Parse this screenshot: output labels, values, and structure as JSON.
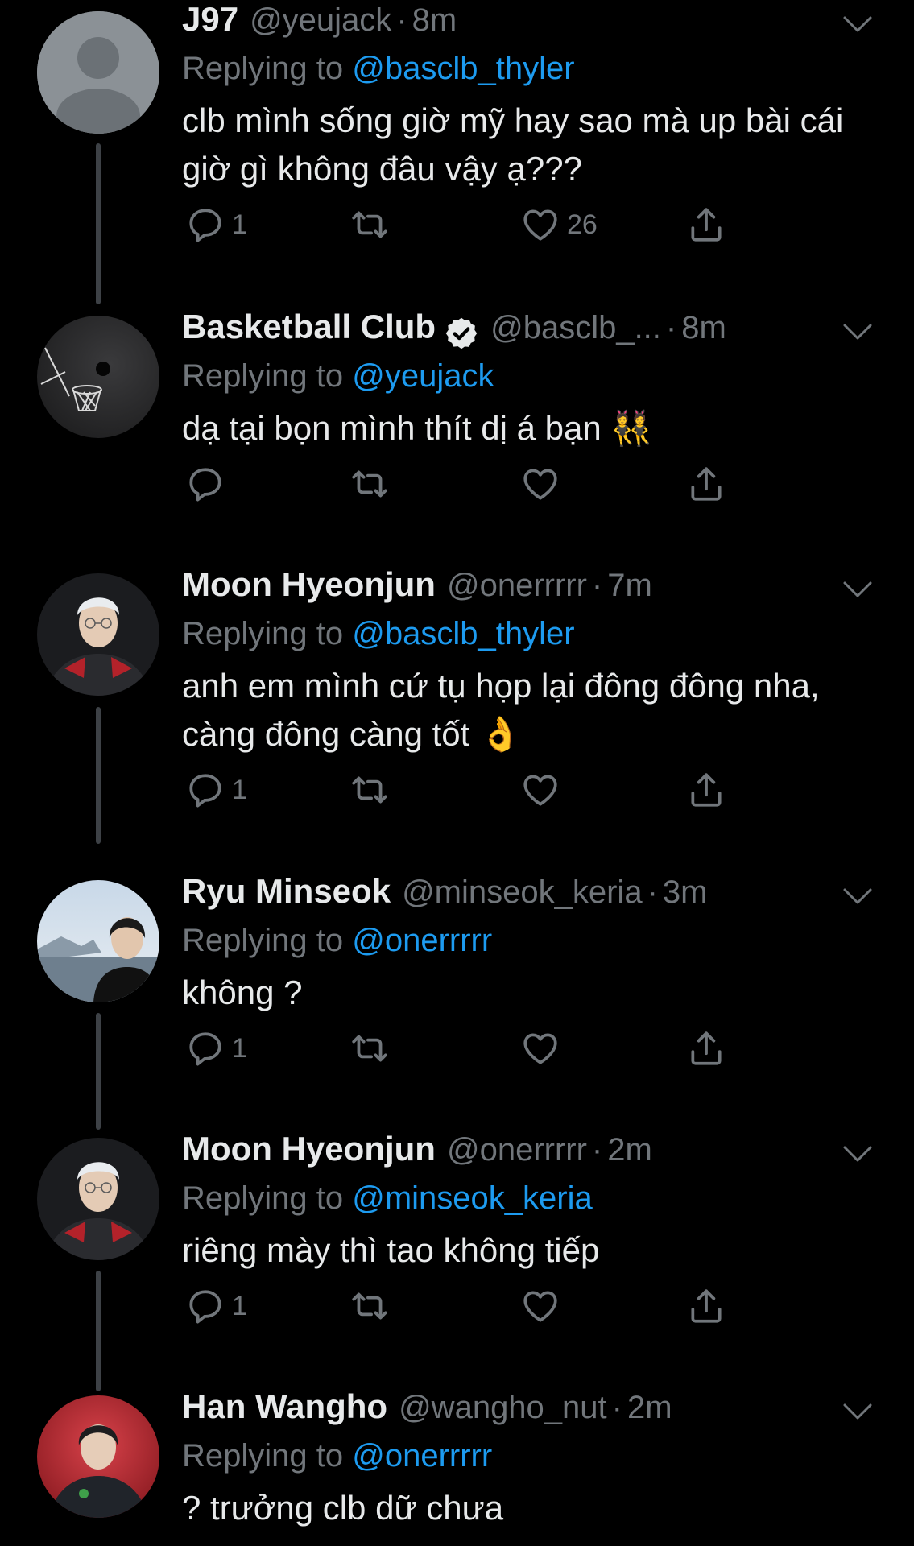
{
  "tweets": [
    {
      "name": "J97",
      "handle": "@yeujack",
      "time": "8m",
      "replying_prefix": "Replying to ",
      "replying_to": "@basclb_thyler",
      "text": "clb mình sống giờ mỹ hay sao mà up bài cái giờ gì không đâu vậy ạ???",
      "reply_count": "1",
      "retweet_count": "",
      "like_count": "26",
      "verified": false
    },
    {
      "name": "Basketball Club",
      "handle": "@basclb_...",
      "time": "8m",
      "replying_prefix": "Replying to ",
      "replying_to": "@yeujack",
      "text": "dạ tại bọn mình thít dị á bạn 👯",
      "reply_count": "",
      "retweet_count": "",
      "like_count": "",
      "verified": true
    },
    {
      "name": "Moon Hyeonjun",
      "handle": "@onerrrrr",
      "time": "7m",
      "replying_prefix": "Replying to ",
      "replying_to": "@basclb_thyler",
      "text": "anh em mình cứ tụ họp lại đông đông nha, càng đông càng tốt 👌",
      "reply_count": "1",
      "retweet_count": "",
      "like_count": "",
      "verified": false
    },
    {
      "name": "Ryu Minseok",
      "handle": "@minseok_keria",
      "time": "3m",
      "replying_prefix": "Replying to ",
      "replying_to": "@onerrrrr",
      "text": "không ?",
      "reply_count": "1",
      "retweet_count": "",
      "like_count": "",
      "verified": false
    },
    {
      "name": "Moon Hyeonjun",
      "handle": "@onerrrrr",
      "time": "2m",
      "replying_prefix": "Replying to ",
      "replying_to": "@minseok_keria",
      "text": "riêng mày thì tao không tiếp",
      "reply_count": "1",
      "retweet_count": "",
      "like_count": "",
      "verified": false
    },
    {
      "name": "Han Wangho",
      "handle": "@wangho_nut",
      "time": "2m",
      "replying_prefix": "Replying to ",
      "replying_to": "@onerrrrr",
      "text": "? trưởng clb dữ chưa",
      "reply_count": "",
      "retweet_count": "",
      "like_count": "",
      "verified": false
    }
  ],
  "colors": {
    "background": "#000000",
    "primary_text": "#e7e9ea",
    "secondary_text": "#71767b",
    "accent": "#1d9bf0"
  }
}
